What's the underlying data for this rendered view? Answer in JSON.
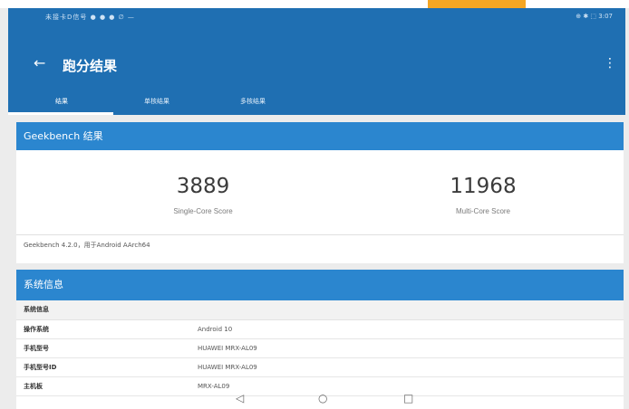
{
  "status_bar": {
    "left": "未接卡D信号 ● ● ● ∅ —",
    "right": "⊕ ✱ ⬚ 3:07"
  },
  "appbar": {
    "title": "跑分结果"
  },
  "tabs": [
    {
      "label": "结果"
    },
    {
      "label": "单核结果"
    },
    {
      "label": "多核结果"
    }
  ],
  "geekbench": {
    "header": "Geekbench 结果",
    "single": {
      "score": "3889",
      "label": "Single-Core Score"
    },
    "multi": {
      "score": "11968",
      "label": "Multi-Core Score"
    },
    "footer": "Geekbench 4.2.0，用于Android AArch64"
  },
  "system_info": {
    "header": "系统信息",
    "section": "系统信息",
    "rows": [
      {
        "key": "操作系统",
        "value": "Android 10"
      },
      {
        "key": "手机型号",
        "value": "HUAWEI MRX-AL09"
      },
      {
        "key": "手机型号ID",
        "value": "HUAWEI MRX-AL09"
      },
      {
        "key": "主机板",
        "value": "MRX-AL09"
      }
    ]
  },
  "navbar": {
    "back": "◁",
    "home": "○",
    "recents": "□"
  }
}
